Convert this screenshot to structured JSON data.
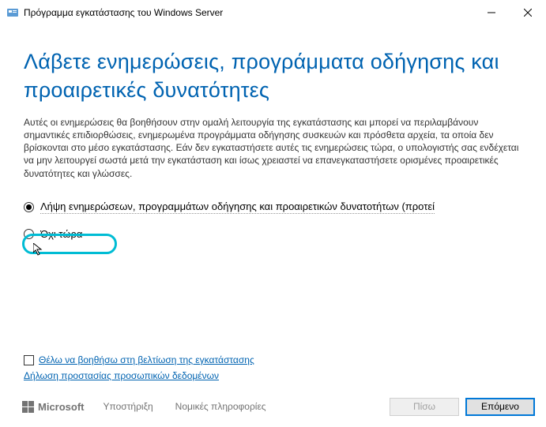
{
  "window": {
    "title": "Πρόγραμμα εγκατάστασης του Windows Server"
  },
  "heading": "Λάβετε ενημερώσεις, προγράμματα οδήγησης και προαιρετικές δυνατότητες",
  "description": "Αυτές οι ενημερώσεις θα βοηθήσουν στην ομαλή λειτουργία της εγκατάστασης και μπορεί να περιλαμβάνουν σημαντικές επιδιορθώσεις, ενημερωμένα προγράμματα οδήγησης συσκευών και πρόσθετα αρχεία, τα οποία δεν βρίσκονται στο μέσο εγκατάστασης. Εάν δεν εγκαταστήσετε αυτές τις ενημερώσεις τώρα, ο υπολογιστής σας ενδέχεται να μην λειτουργεί σωστά μετά την εγκατάσταση και ίσως χρειαστεί να επανεγκαταστήσετε ορισμένες προαιρετικές δυνατότητες και γλώσσες.",
  "options": {
    "get_updates": "Λήψη ενημερώσεων, προγραμμάτων οδήγησης και προαιρετικών δυνατοτήτων (προτεί",
    "not_now": "Όχι τώρα"
  },
  "bottom": {
    "improve_checkbox": "Θέλω να βοηθήσω στη βελτίωση της εγκατάστασης",
    "privacy": "Δήλωση προστασίας προσωπικών δεδομένων"
  },
  "footer": {
    "microsoft": "Microsoft",
    "support": "Υποστήριξη",
    "legal": "Νομικές πληροφορίες",
    "back": "Πίσω",
    "next": "Επόμενο"
  }
}
